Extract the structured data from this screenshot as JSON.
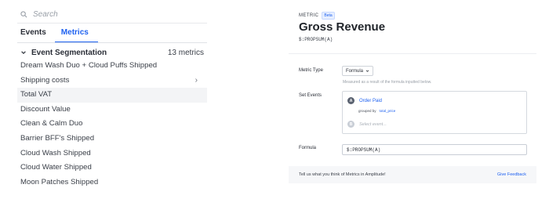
{
  "sidebar": {
    "search": {
      "placeholder": "Search",
      "icon": "search-icon"
    },
    "tabs": [
      {
        "label": "Events",
        "active": false
      },
      {
        "label": "Metrics",
        "active": true
      }
    ],
    "group": {
      "title": "Event Segmentation",
      "count": "13 metrics",
      "expanded": true
    },
    "metrics": [
      {
        "label": "Dream Wash Duo + Cloud Puffs Shipped"
      },
      {
        "label": "Shipping costs",
        "chevron": "›"
      },
      {
        "label": "Total VAT",
        "selected": true
      },
      {
        "label": "Discount Value"
      },
      {
        "label": "Clean & Calm Duo"
      },
      {
        "label": "Barrier BFF's Shipped"
      },
      {
        "label": "Cloud Wash Shipped"
      },
      {
        "label": "Cloud Water Shipped"
      },
      {
        "label": "Moon Patches Shipped"
      }
    ]
  },
  "detail": {
    "kind": "METRIC",
    "badge": "Beta",
    "title": "Gross Revenue",
    "formula_summary": "$:PROPSUM(A)",
    "metric_type": {
      "label": "Metric Type",
      "value": "Formula",
      "hint": "Measured as a result of the formula inputted below."
    },
    "set_events": {
      "label": "Set Events",
      "events": [
        {
          "letter": "A",
          "name": "Order Paid",
          "grouped_by_label": "grouped by",
          "grouped_by_value": "total_price"
        },
        {
          "letter": "B",
          "placeholder": "Select event..."
        }
      ]
    },
    "formula": {
      "label": "Formula",
      "value": "$:PROPSUM(A)"
    },
    "footer": {
      "message": "Tell us what you think of Metrics in Amplitude!",
      "feedback": "Give Feedback"
    }
  },
  "colors": {
    "accent": "#1e61f0",
    "text": "#2b2f38",
    "muted": "#9aa0a8",
    "selected_row": "#f3f4f6"
  }
}
